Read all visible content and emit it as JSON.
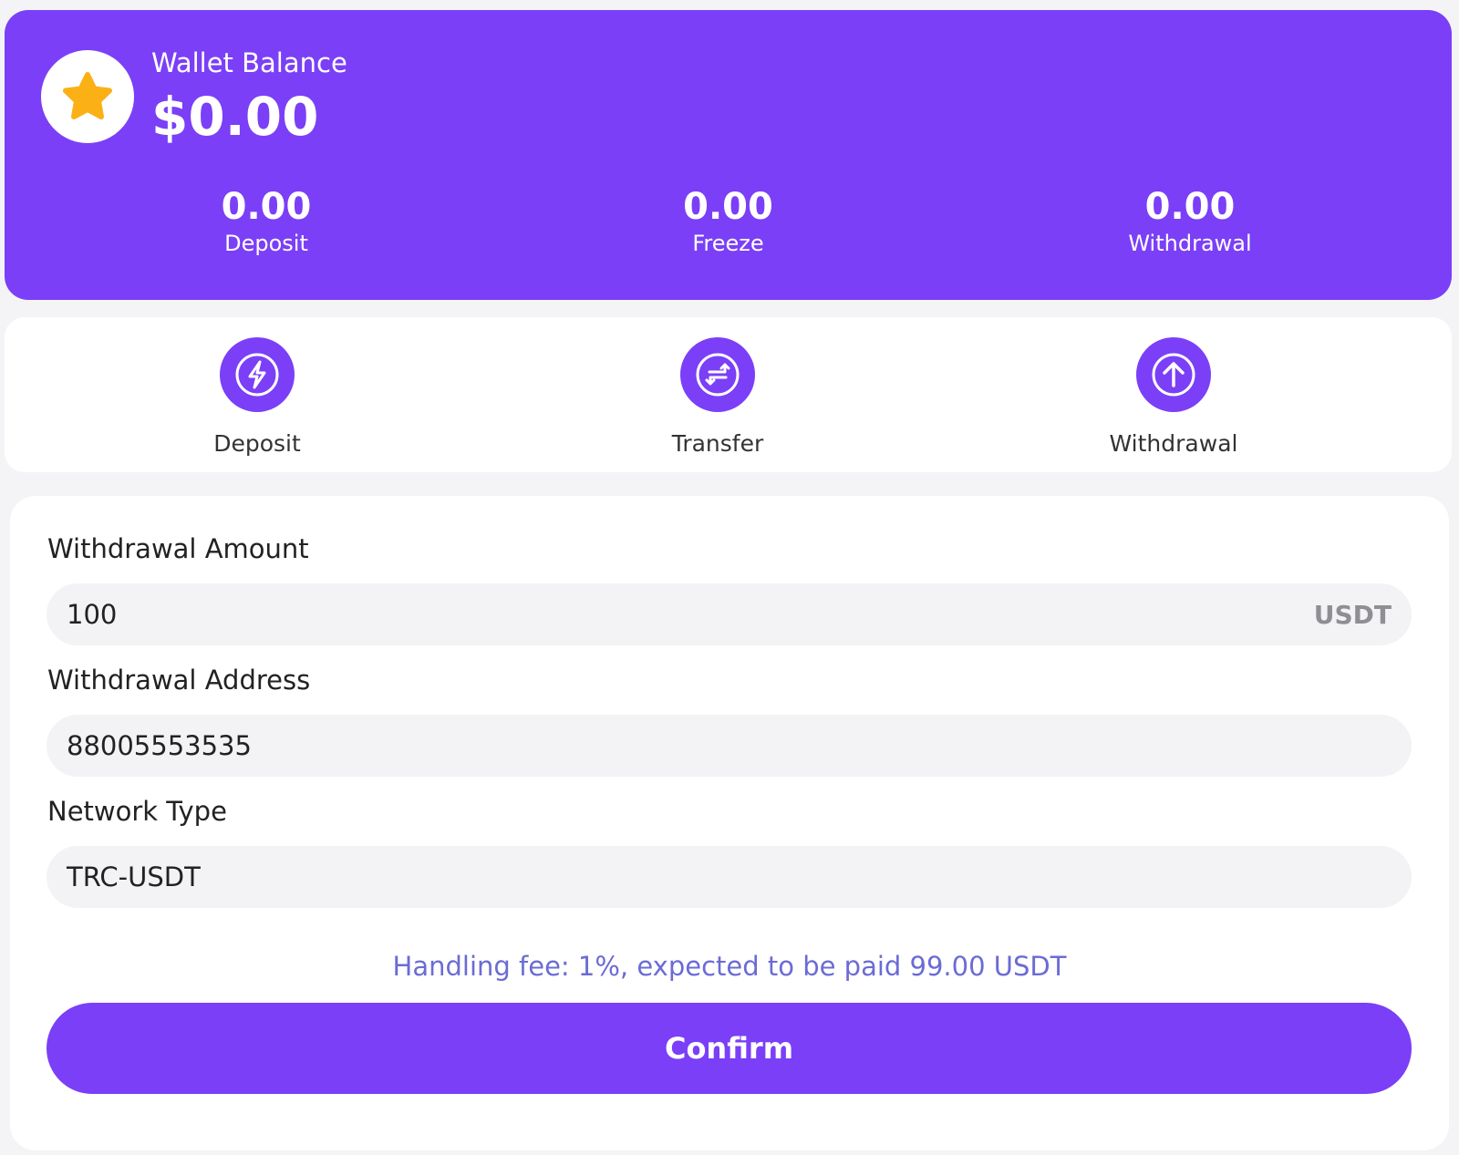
{
  "wallet": {
    "balance_label": "Wallet Balance",
    "balance_value": "$0.00",
    "stats": [
      {
        "value": "0.00",
        "label": "Deposit"
      },
      {
        "value": "0.00",
        "label": "Freeze"
      },
      {
        "value": "0.00",
        "label": "Withdrawal"
      }
    ]
  },
  "actions": [
    {
      "label": "Deposit",
      "icon": "lightning-icon"
    },
    {
      "label": "Transfer",
      "icon": "transfer-arrows-icon"
    },
    {
      "label": "Withdrawal",
      "icon": "arrow-up-icon"
    }
  ],
  "form": {
    "amount_label": "Withdrawal Amount",
    "amount_value": "100",
    "amount_suffix": "USDT",
    "address_label": "Withdrawal Address",
    "address_value": "88005553535",
    "network_label": "Network Type",
    "network_value": "TRC-USDT",
    "fee_note": "Handling fee: 1%, expected to be paid 99.00 USDT",
    "confirm_label": "Confirm"
  },
  "colors": {
    "accent": "#7b3ff7",
    "star": "#fbb016",
    "fee_text": "#6b6bd6"
  }
}
